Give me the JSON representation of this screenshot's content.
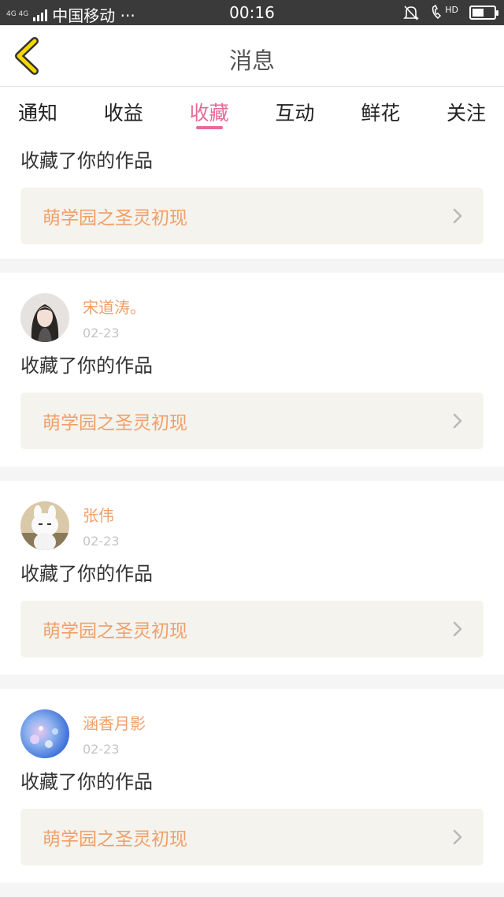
{
  "status_bar": {
    "network": "4G 4G",
    "carrier": "中国移动 ···",
    "time": "00:16",
    "hd": "HD",
    "battery_level": 0.55
  },
  "header": {
    "title": "消息"
  },
  "tabs": [
    {
      "label": "通知"
    },
    {
      "label": "收益"
    },
    {
      "label": "收藏",
      "active": true
    },
    {
      "label": "互动"
    },
    {
      "label": "鲜花"
    },
    {
      "label": "关注"
    }
  ],
  "items": [
    {
      "action": "收藏了你的作品",
      "work_title": "萌学园之圣灵初现"
    },
    {
      "user": "宋道涛。",
      "date": "02-23",
      "action": "收藏了你的作品",
      "work_title": "萌学园之圣灵初现"
    },
    {
      "user": "张伟",
      "date": "02-23",
      "action": "收藏了你的作品",
      "work_title": "萌学园之圣灵初现"
    },
    {
      "user": "涵香月影",
      "date": "02-23",
      "action": "收藏了你的作品",
      "work_title": "萌学园之圣灵初现"
    }
  ],
  "colors": {
    "accent": "#e86a9a",
    "work_text": "#f0a06a",
    "back_arrow": "#f5d800"
  }
}
